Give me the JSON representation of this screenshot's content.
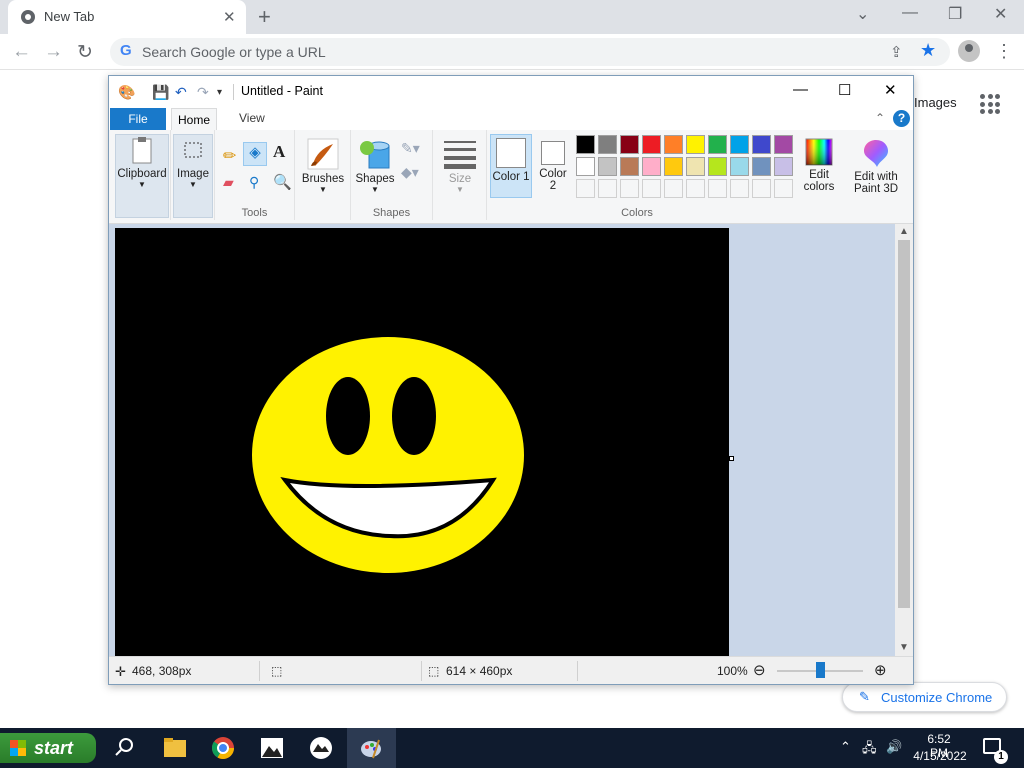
{
  "browser": {
    "tab_title": "New Tab",
    "omnibox_placeholder": "Search Google or type a URL",
    "images_link": "Images",
    "customize_label": "Customize Chrome"
  },
  "paint": {
    "window_title": "Untitled - Paint",
    "tabs": {
      "file": "File",
      "home": "Home",
      "view": "View"
    },
    "ribbon": {
      "clipboard": "Clipboard",
      "image": "Image",
      "tools_group": "Tools",
      "brushes": "Brushes",
      "shapes": "Shapes",
      "shapes_group": "Shapes",
      "size": "Size",
      "color1": "Color 1",
      "color2": "Color 2",
      "colors_group": "Colors",
      "edit_colors_line1": "Edit",
      "edit_colors_line2": "colors",
      "paint3d_line1": "Edit with",
      "paint3d_line2": "Paint 3D"
    },
    "palette_row1": [
      "#000000",
      "#7f7f7f",
      "#880015",
      "#ed1c24",
      "#ff7f27",
      "#fff200",
      "#22b14c",
      "#00a2e8",
      "#3f48cc",
      "#a349a4"
    ],
    "palette_row2": [
      "#ffffff",
      "#c3c3c3",
      "#b97a57",
      "#ffaec9",
      "#ffc90e",
      "#efe4b0",
      "#b5e61d",
      "#99d9ea",
      "#7092be",
      "#c8bfe7"
    ],
    "color1_value": "#ffffff",
    "color2_value": "#ffffff",
    "status": {
      "cursor_pos": "468, 308px",
      "canvas_size": "614 × 460px",
      "zoom": "100%",
      "zoom_fraction": 0.5
    },
    "drawing": {
      "background": "#000000",
      "face_color": "#fff200",
      "mouth_color": "#ffffff"
    }
  },
  "taskbar": {
    "start_label": "start",
    "time": "6:52 PM",
    "date": "4/15/2022",
    "notification_count": "1"
  }
}
